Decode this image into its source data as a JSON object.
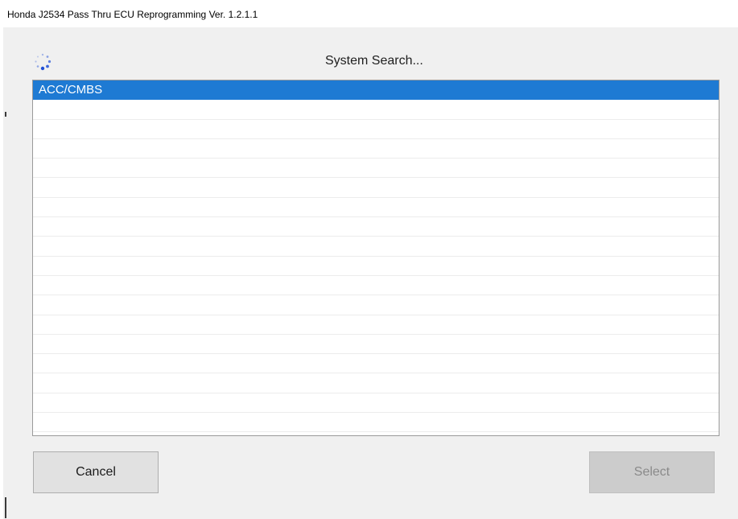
{
  "window": {
    "title": "Honda J2534 Pass Thru ECU Reprogramming Ver. 1.2.1.1"
  },
  "status": {
    "text": "System Search...",
    "icon": "loading-spinner-icon"
  },
  "list": {
    "items": [
      {
        "label": "ACC/CMBS",
        "selected": true
      },
      {
        "label": ""
      },
      {
        "label": ""
      },
      {
        "label": ""
      },
      {
        "label": ""
      },
      {
        "label": ""
      },
      {
        "label": ""
      },
      {
        "label": ""
      },
      {
        "label": ""
      },
      {
        "label": ""
      },
      {
        "label": ""
      },
      {
        "label": ""
      },
      {
        "label": ""
      },
      {
        "label": ""
      },
      {
        "label": ""
      },
      {
        "label": ""
      },
      {
        "label": ""
      },
      {
        "label": ""
      }
    ]
  },
  "buttons": {
    "cancel_label": "Cancel",
    "select_label": "Select",
    "select_enabled": false
  },
  "colors": {
    "selection": "#1e7ad3",
    "spinner": "#1f4fd6"
  }
}
